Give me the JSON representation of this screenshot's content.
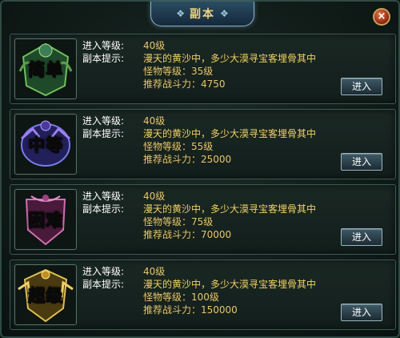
{
  "title": "副本",
  "close_label": "×",
  "dungeons": [
    {
      "emblem_text": "简单",
      "emblem_color": "#7ad05a",
      "level_label": "进入等级:",
      "level": "40级",
      "hint_label": "副本提示:",
      "hint": "漫天的黄沙中，多少大漠寻宝客埋骨其中",
      "monster_level": "怪物等级：35级",
      "power": "推荐战斗力：4750",
      "enter_label": "进入"
    },
    {
      "emblem_text": "中等",
      "emblem_color": "#5a7de0",
      "level_label": "进入等级:",
      "level": "40级",
      "hint_label": "副本提示:",
      "hint": "漫天的黄沙中，多少大漠寻宝客埋骨其中",
      "monster_level": "怪物等级：55级",
      "power": "推荐战斗力：25000",
      "enter_label": "进入"
    },
    {
      "emblem_text": "困难",
      "emblem_color": "#d050a0",
      "level_label": "进入等级:",
      "level": "40级",
      "hint_label": "副本提示:",
      "hint": "漫天的黄沙中，多少大漠寻宝客埋骨其中",
      "monster_level": "怪物等级：75级",
      "power": "推荐战斗力：70000",
      "enter_label": "进入"
    },
    {
      "emblem_text": "超级",
      "emblem_color": "#e0b838",
      "level_label": "进入等级:",
      "level": "40级",
      "hint_label": "副本提示:",
      "hint": "漫天的黄沙中，多少大漠寻宝客埋骨其中",
      "monster_level": "怪物等级：100级",
      "power": "推荐战斗力：150000",
      "enter_label": "进入"
    }
  ]
}
